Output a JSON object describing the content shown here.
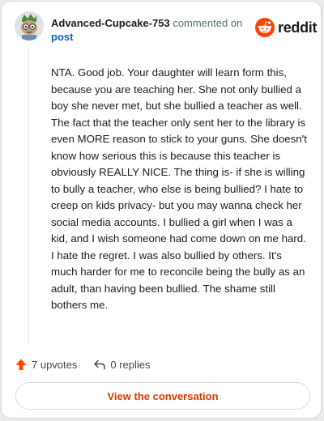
{
  "header": {
    "author": "Advanced-Cupcake-753",
    "action_text": "commented on",
    "post_link": "post",
    "brand": "reddit",
    "brand_icon": "reddit-snoo-icon",
    "avatar_icon": "user-avatar-icon"
  },
  "comment": {
    "body": "NTA. Good job. Your daughter will learn form this, because you are teaching her. She not only bullied a boy she never met, but she bullied a teacher as well. The fact that the teacher only sent her to the library is even MORE reason to stick to your guns. She doesn't know how serious this is because this teacher is obviously REALLY NICE. The thing is- if she is willing to bully a teacher, who else is being bullied? I hate to creep on kids privacy- but you may wanna check her social media accounts. I bullied a girl when I was a kid, and I wish someone had come down on me hard. I hate the regret. I was also bullied by others. It's much harder for me to reconcile being the bully as an adult, than having been bullied. The shame still bothers me."
  },
  "actions": {
    "upvotes": "7 upvotes",
    "upvote_icon": "upvote-arrow-icon",
    "replies": "0 replies",
    "reply_icon": "reply-arrow-icon"
  },
  "cta": {
    "label": "View the conversation"
  },
  "colors": {
    "accent": "#d93a00",
    "link": "#0a66c2",
    "brand": "#ff4500"
  }
}
